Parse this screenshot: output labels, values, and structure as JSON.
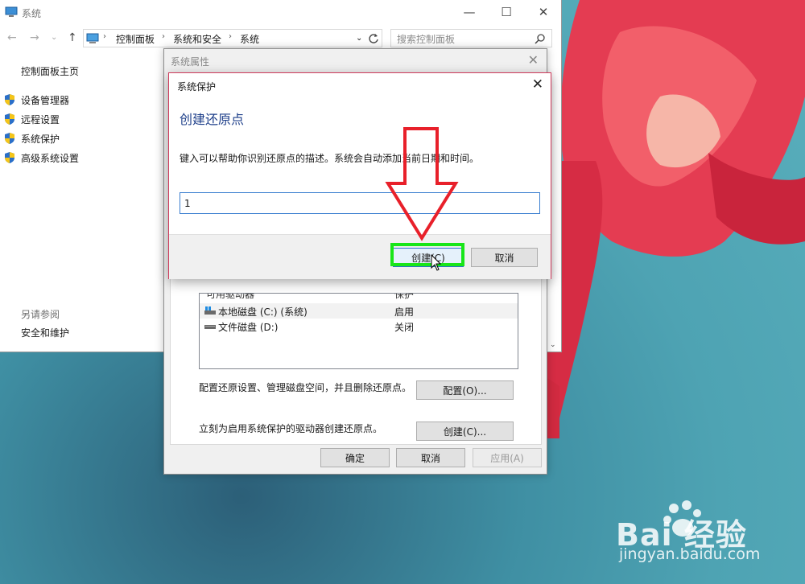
{
  "system_window": {
    "title": "系统",
    "caption_minimize": "—",
    "caption_maximize": "☐",
    "caption_close": "✕",
    "nav": {
      "back": "←",
      "forward": "→",
      "recent": "⌄",
      "up": "↑"
    },
    "breadcrumb": [
      "控制面板",
      "系统和安全",
      "系统"
    ],
    "search_placeholder": "搜索控制面板",
    "sidebar": {
      "home": "控制面板主页",
      "items": [
        "设备管理器",
        "远程设置",
        "系统保护",
        "高级系统设置"
      ],
      "see_also": "另请参阅",
      "security": "安全和维护"
    }
  },
  "system_properties": {
    "title": "系统属性",
    "drive_header": {
      "name": "可用驱动器",
      "protection": "保护"
    },
    "drives": [
      {
        "name": "本地磁盘 (C:) (系统)",
        "protection": "启用",
        "icon": "system-drive-icon"
      },
      {
        "name": "文件磁盘 (D:)",
        "protection": "关闭",
        "icon": "drive-icon"
      }
    ],
    "configure_text": "配置还原设置、管理磁盘空间，并且删除还原点。",
    "configure_button": "配置(O)...",
    "create_text": "立刻为启用系统保护的驱动器创建还原点。",
    "create_button": "创建(C)...",
    "ok_button": "确定",
    "cancel_button": "取消",
    "apply_button": "应用(A)"
  },
  "system_protection": {
    "title": "系统保护",
    "heading": "创建还原点",
    "description": "键入可以帮助你识别还原点的描述。系统会自动添加当前日期和时间。",
    "input_value": "1",
    "create_button": "创建(C)",
    "cancel_button": "取消"
  },
  "watermark": {
    "brand": "Bai  经验",
    "url": "jingyan.baidu.com"
  },
  "colors": {
    "arrow": "#e8202a",
    "highlight": "#18e618",
    "dialog_border": "#cf3a5b",
    "heading": "#1e3f8a"
  }
}
